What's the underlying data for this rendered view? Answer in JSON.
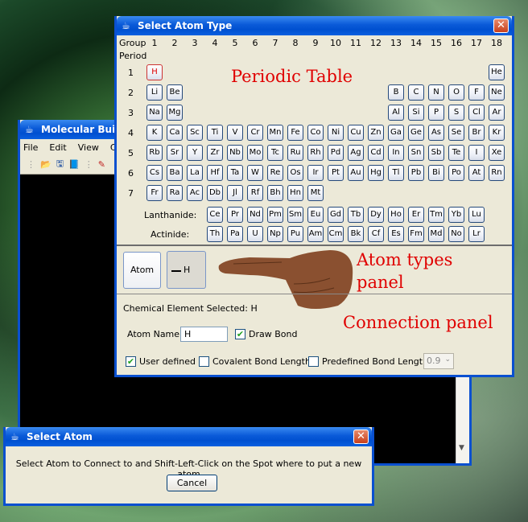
{
  "molecular_builder": {
    "title": "Molecular Build",
    "menu": [
      "File",
      "Edit",
      "View",
      "Cal"
    ]
  },
  "select_atom_type": {
    "title": "Select Atom Type",
    "group_label": "Group",
    "period_label": "Period",
    "groups": [
      "1",
      "2",
      "3",
      "4",
      "5",
      "6",
      "7",
      "8",
      "9",
      "10",
      "11",
      "12",
      "13",
      "14",
      "15",
      "16",
      "17",
      "18"
    ],
    "periods": [
      "1",
      "2",
      "3",
      "4",
      "5",
      "6",
      "7"
    ],
    "periodic_table_annotation": "Periodic Table",
    "elements": [
      [
        "H",
        null,
        null,
        null,
        null,
        null,
        null,
        null,
        null,
        null,
        null,
        null,
        null,
        null,
        null,
        null,
        null,
        "He"
      ],
      [
        "Li",
        "Be",
        null,
        null,
        null,
        null,
        null,
        null,
        null,
        null,
        null,
        null,
        "B",
        "C",
        "N",
        "O",
        "F",
        "Ne"
      ],
      [
        "Na",
        "Mg",
        null,
        null,
        null,
        null,
        null,
        null,
        null,
        null,
        null,
        null,
        "Al",
        "Si",
        "P",
        "S",
        "Cl",
        "Ar"
      ],
      [
        "K",
        "Ca",
        "Sc",
        "Ti",
        "V",
        "Cr",
        "Mn",
        "Fe",
        "Co",
        "Ni",
        "Cu",
        "Zn",
        "Ga",
        "Ge",
        "As",
        "Se",
        "Br",
        "Kr"
      ],
      [
        "Rb",
        "Sr",
        "Y",
        "Zr",
        "Nb",
        "Mo",
        "Tc",
        "Ru",
        "Rh",
        "Pd",
        "Ag",
        "Cd",
        "In",
        "Sn",
        "Sb",
        "Te",
        "I",
        "Xe"
      ],
      [
        "Cs",
        "Ba",
        "La",
        "Hf",
        "Ta",
        "W",
        "Re",
        "Os",
        "Ir",
        "Pt",
        "Au",
        "Hg",
        "Tl",
        "Pb",
        "Bi",
        "Po",
        "At",
        "Rn"
      ],
      [
        "Fr",
        "Ra",
        "Ac",
        "Db",
        "Jl",
        "Rf",
        "Bh",
        "Hn",
        "Mt",
        null,
        null,
        null,
        null,
        null,
        null,
        null,
        null,
        null
      ]
    ],
    "selected_element": "H",
    "lanthanide_label": "Lanthanide:",
    "lanthanides": [
      "Ce",
      "Pr",
      "Nd",
      "Pm",
      "Sm",
      "Eu",
      "Gd",
      "Tb",
      "Dy",
      "Ho",
      "Er",
      "Tm",
      "Yb",
      "Lu"
    ],
    "actinide_label": "Actinide:",
    "actinides": [
      "Th",
      "Pa",
      "U",
      "Np",
      "Pu",
      "Am",
      "Cm",
      "Bk",
      "Cf",
      "Es",
      "Fm",
      "Md",
      "No",
      "Lr"
    ],
    "atom_button_label": "Atom",
    "bond_atom_button_label": "H",
    "atom_types_annotation_line1": "Atom types",
    "atom_types_annotation_line2": "panel",
    "chemical_element_selected": "Chemical Element Selected: H",
    "connection_annotation": "Connection panel",
    "atom_name_label": "Atom Name:",
    "atom_name_value": "H",
    "draw_bond_label": "Draw Bond",
    "draw_bond_checked": true,
    "user_defined_label": "User defined",
    "user_defined_checked": true,
    "covalent_bond_label": "Covalent Bond Length",
    "covalent_bond_checked": false,
    "predefined_bond_label": "Predefined Bond Length",
    "predefined_bond_checked": false,
    "predefined_bond_value": "0.9"
  },
  "select_atom": {
    "title": "Select Atom",
    "message": "Select Atom to Connect to and Shift-Left-Click on the Spot where to put a new atom",
    "cancel_label": "Cancel"
  },
  "colors": {
    "title_bar": "#0a5ad8",
    "annotation": "#e00000",
    "selected_element": "#dd0000"
  }
}
